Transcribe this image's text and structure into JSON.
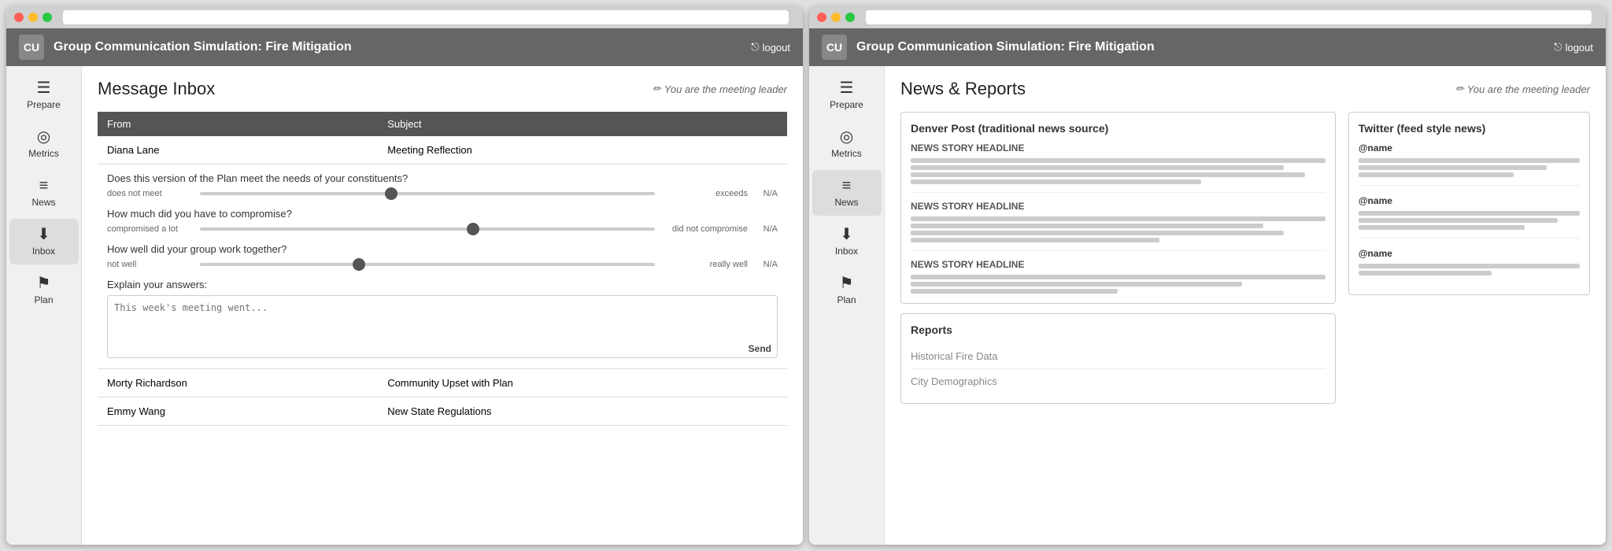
{
  "app": {
    "title": "Group Communication Simulation: Fire Mitigation",
    "logo": "CU",
    "logout_label": "logout"
  },
  "window1": {
    "sidebar": {
      "items": [
        {
          "id": "prepare",
          "label": "Prepare",
          "icon": "☰"
        },
        {
          "id": "metrics",
          "label": "Metrics",
          "icon": "◎"
        },
        {
          "id": "news",
          "label": "News",
          "icon": "≡"
        },
        {
          "id": "inbox",
          "label": "Inbox",
          "icon": "⬇"
        },
        {
          "id": "plan",
          "label": "Plan",
          "icon": "⚑"
        }
      ],
      "active": "inbox"
    },
    "main": {
      "page_title": "Message Inbox",
      "meeting_leader": "You are the meeting leader",
      "table": {
        "columns": [
          "From",
          "Subject"
        ],
        "rows": [
          {
            "from": "Diana Lane",
            "subject": "Meeting Reflection",
            "expanded": true,
            "content": {
              "subject_title": "Meeting Reflection",
              "sliders": [
                {
                  "question": "Does this version of the Plan meet the needs of your constituents?",
                  "left_label": "does not meet",
                  "right_label": "exceeds",
                  "na_label": "N/A",
                  "thumb_pos": "42"
                },
                {
                  "question": "How much did you have to compromise?",
                  "left_label": "compromised a lot",
                  "right_label": "did not compromise",
                  "na_label": "N/A",
                  "thumb_pos": "60"
                },
                {
                  "question": "How well did your group work together?",
                  "left_label": "not well",
                  "right_label": "really well",
                  "na_label": "N/A",
                  "thumb_pos": "35"
                }
              ],
              "explain_label": "Explain your answers:",
              "explain_placeholder": "This week's meeting went...",
              "send_label": "Send"
            }
          },
          {
            "from": "Morty Richardson",
            "subject": "Community Upset with Plan",
            "expanded": false
          },
          {
            "from": "Emmy Wang",
            "subject": "New State Regulations",
            "expanded": false
          }
        ]
      }
    }
  },
  "window2": {
    "sidebar": {
      "items": [
        {
          "id": "prepare",
          "label": "Prepare",
          "icon": "☰"
        },
        {
          "id": "metrics",
          "label": "Metrics",
          "icon": "◎"
        },
        {
          "id": "news",
          "label": "News",
          "icon": "≡"
        },
        {
          "id": "inbox",
          "label": "Inbox",
          "icon": "⬇"
        },
        {
          "id": "plan",
          "label": "Plan",
          "icon": "⚑"
        }
      ],
      "active": "news"
    },
    "main": {
      "page_title": "News & Reports",
      "meeting_leader": "You are the meeting leader",
      "denver_post": {
        "header": "Denver Post (traditional news source)",
        "stories": [
          {
            "headline": "NEWS STORY HEADLINE",
            "lines": [
              5,
              4,
              5,
              3
            ]
          },
          {
            "headline": "NEWS STORY HEADLINE",
            "lines": [
              5,
              4,
              5,
              3
            ]
          },
          {
            "headline": "NEWS STORY HEADLINE",
            "lines": [
              4,
              5,
              3
            ]
          }
        ]
      },
      "twitter": {
        "header": "Twitter (feed style news)",
        "items": [
          {
            "handle": "@name",
            "lines": [
              4,
              3,
              4
            ]
          },
          {
            "handle": "@name",
            "lines": [
              4,
              3,
              4
            ]
          },
          {
            "handle": "@name",
            "lines": [
              4,
              3
            ]
          }
        ]
      },
      "reports": {
        "header": "Reports",
        "items": [
          {
            "label": "Historical Fire Data"
          },
          {
            "label": "City Demographics"
          }
        ]
      }
    }
  }
}
